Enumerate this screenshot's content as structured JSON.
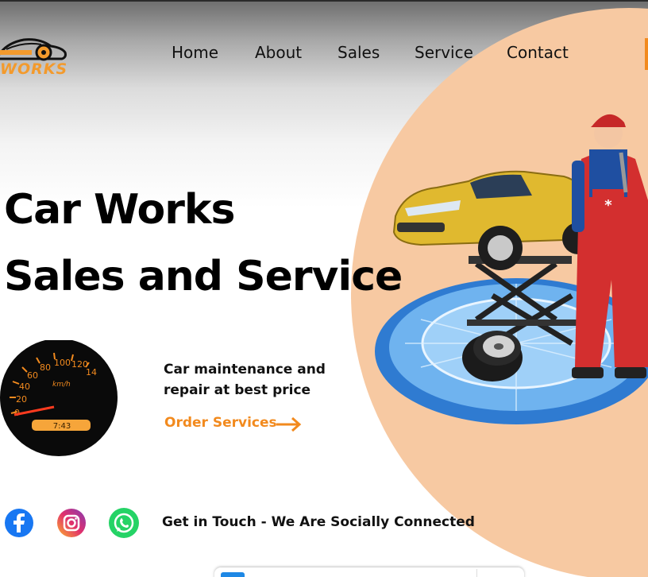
{
  "brand": {
    "logo_text": "WORKS"
  },
  "nav": {
    "items": [
      {
        "label": "Home"
      },
      {
        "label": "About"
      },
      {
        "label": "Sales"
      },
      {
        "label": "Service"
      },
      {
        "label": "Contact"
      }
    ]
  },
  "hero": {
    "title_line1": "Car Works",
    "title_line2": "Sales and Service",
    "description": "Car maintenance and repair at best price",
    "cta_label": "Order Services"
  },
  "speedometer": {
    "ticks": [
      "0",
      "20",
      "40",
      "60",
      "80",
      "100",
      "120",
      "14"
    ],
    "unit": "km/h",
    "display": "7:43"
  },
  "social": {
    "icons": [
      "facebook-icon",
      "instagram-icon",
      "whatsapp-icon"
    ],
    "tagline": "Get in Touch - We  Are Socially Connected"
  },
  "colors": {
    "accent": "#f28a1e",
    "peach": "#f7c9a2",
    "text": "#111111"
  }
}
